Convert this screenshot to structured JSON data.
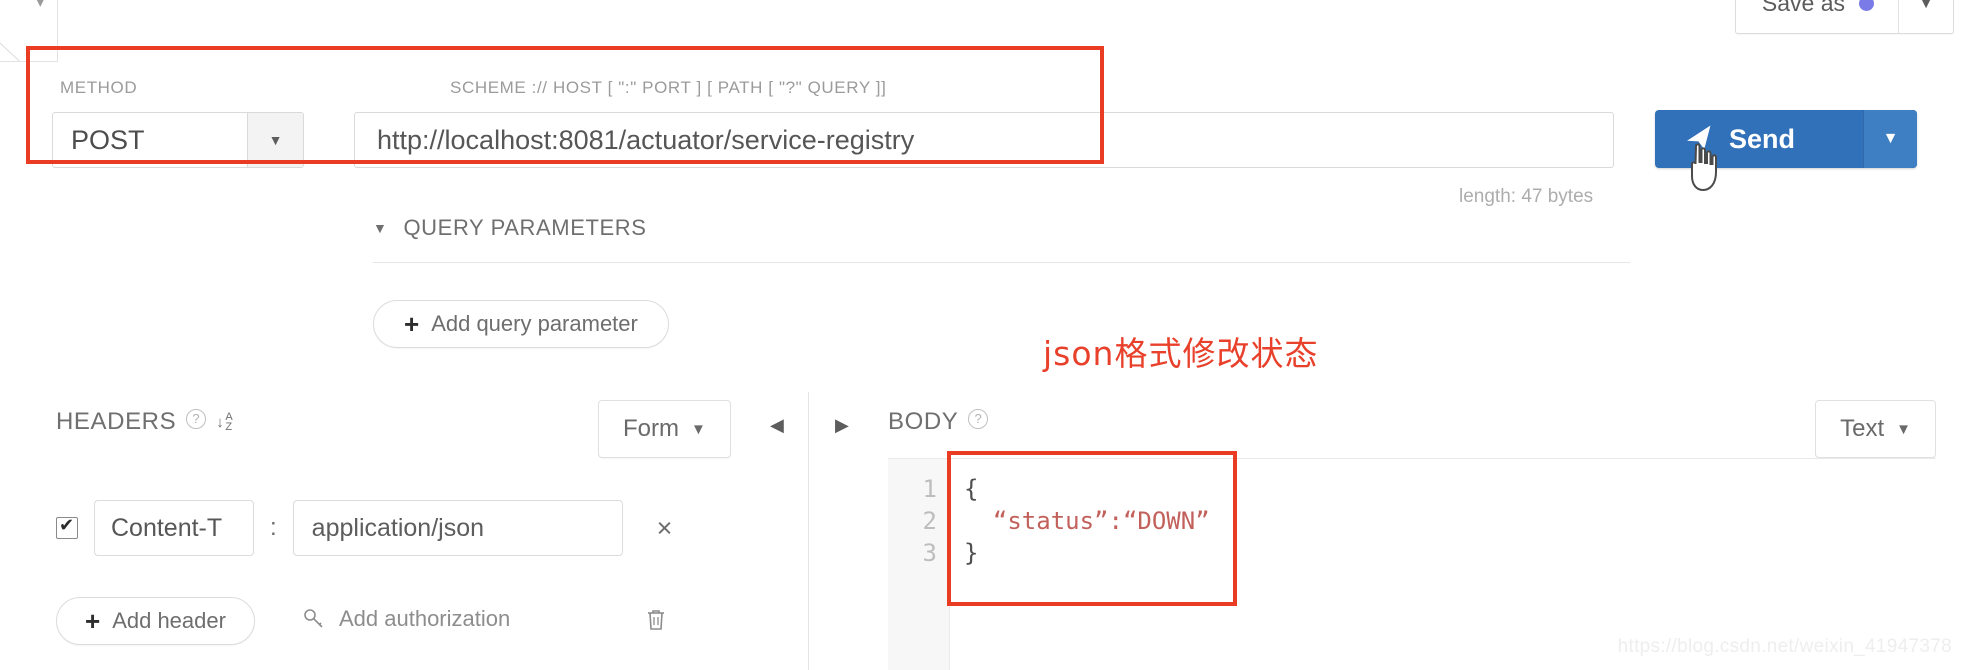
{
  "window": {
    "save_as_label": "Save as",
    "save_as_dot_color": "#7b7be8",
    "save_as_caret": "▼"
  },
  "request": {
    "method_label": "METHOD",
    "method_value": "POST",
    "method_caret": "▼",
    "url_label": "SCHEME :// HOST [ \":\" PORT ] [ PATH [ \"?\" QUERY ]]",
    "url_value": "http://localhost:8081/actuator/service-registry",
    "length_note": "length: 47 bytes",
    "send_label": "Send",
    "send_caret": "▼",
    "send_color": "#3071b9"
  },
  "query_parameters": {
    "section_caret": "▼",
    "section_title": "QUERY PARAMETERS",
    "add_plus": "+",
    "add_label": "Add query parameter"
  },
  "headers_pane": {
    "title": "HEADERS",
    "help_icon": "?",
    "sort_arrow": "↓",
    "sort_a": "A",
    "sort_z": "Z",
    "view_mode": "Form",
    "view_mode_caret": "▼",
    "collapse_left": "◀",
    "collapse_right": "▶",
    "rows": [
      {
        "enabled": true,
        "name": "Content-T",
        "separator": ":",
        "value": "application/json",
        "remove": "×"
      }
    ],
    "add_header_plus": "+",
    "add_header_label": "Add header",
    "add_authorization_label": "Add authorization",
    "key_icon": "⚷",
    "trash_icon": "🗑"
  },
  "body_pane": {
    "title": "BODY",
    "help_icon": "?",
    "format": "Text",
    "format_caret": "▼",
    "line_numbers": [
      "1",
      "2",
      "3"
    ],
    "lines": [
      {
        "prefix": "{",
        "string": "",
        "suffix": ""
      },
      {
        "prefix": "  ",
        "string": "“status”:“DOWN”",
        "suffix": ""
      },
      {
        "prefix": "}",
        "string": "",
        "suffix": ""
      }
    ]
  },
  "annotations": {
    "note_text": "json格式修改状态",
    "note_color": "#e8402a",
    "box_color": "#ea3c22"
  },
  "watermark": {
    "text": "https://blog.csdn.net/weixin_41947378"
  }
}
